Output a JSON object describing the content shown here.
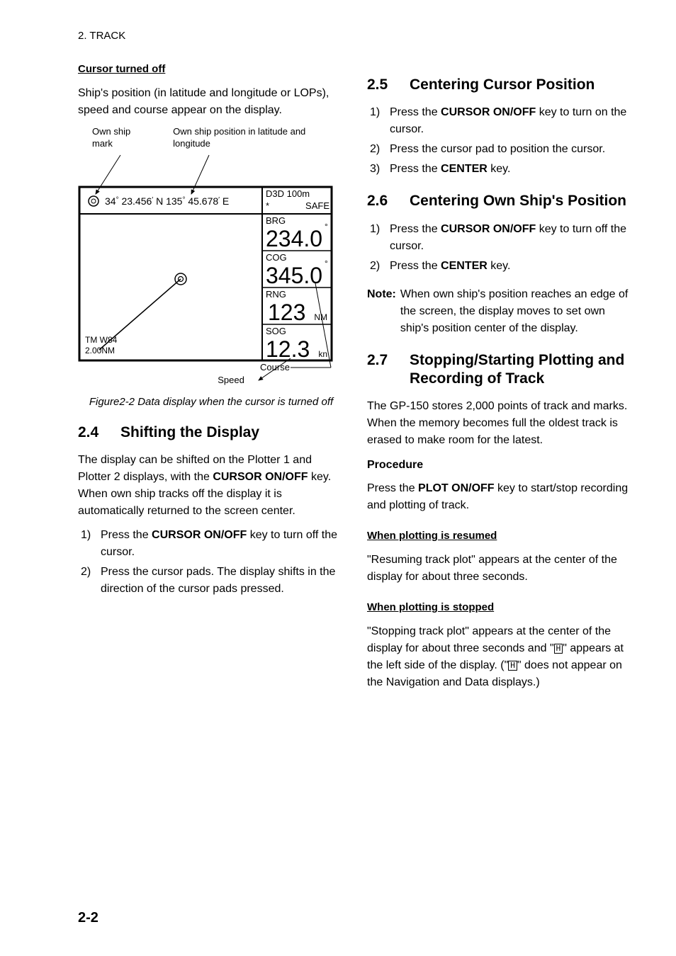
{
  "header": "2. TRACK",
  "page_number": "2-2",
  "left": {
    "cursor_off_title": "Cursor turned off",
    "cursor_off_para": "Ship's position (in latitude and longitude or LOPs), speed and course appear on the display.",
    "diagram": {
      "label_own_ship_mark": "Own ship mark",
      "label_own_ship_pos": "Own ship position in latitude and longitude",
      "lat": "34",
      "lat_min": "23.456",
      "lat_hemi": "N",
      "lon": "135",
      "lon_min": "45.678",
      "lon_hemi": "E",
      "d3d": "D3D 100m",
      "safe": "SAFE",
      "star": "*",
      "brg_label": "BRG",
      "brg_val": "234.0",
      "cog_label": "COG",
      "cog_val": "345.0",
      "rng_label": "RNG",
      "rng_val": "123",
      "rng_unit": "NM",
      "sog_label": "SOG",
      "sog_val": "12.3",
      "sog_unit": "kn",
      "tm": "TM W84",
      "scale": "2.00NM",
      "label_course": "Course",
      "label_speed": "Speed"
    },
    "fig_caption": "Figure2-2 Data display when the cursor is turned off",
    "s24num": "2.4",
    "s24title": "Shifting the Display",
    "s24para_pre": "The display can be shifted on the Plotter 1 and Plotter 2 displays, with the ",
    "s24para_key": "CURSOR ON/OFF",
    "s24para_post": " key. When own ship tracks off the display it is automatically returned to the screen center.",
    "s24_1_pre": "Press the ",
    "s24_1_key": "CURSOR ON/OFF",
    "s24_1_post": " key to turn off the cursor.",
    "s24_2": "Press the cursor pads. The display shifts in the direction of the cursor pads pressed."
  },
  "right": {
    "s25num": "2.5",
    "s25title": "Centering Cursor Position",
    "s25_1_pre": "Press the ",
    "s25_1_key": "CURSOR ON/OFF",
    "s25_1_post": " key to turn on the cursor.",
    "s25_2": "Press the cursor pad to position the cursor.",
    "s25_3_pre": "Press the ",
    "s25_3_key": "CENTER",
    "s25_3_post": " key.",
    "s26num": "2.6",
    "s26title": "Centering Own Ship's Position",
    "s26_1_pre": "Press the ",
    "s26_1_key": "CURSOR ON/OFF",
    "s26_1_post": " key to turn off the cursor.",
    "s26_2_pre": "Press the ",
    "s26_2_key": "CENTER",
    "s26_2_post": " key.",
    "note_label": "Note:",
    "note_body": "When own ship's position reaches an edge of the screen, the display moves to set own ship's position center of the display.",
    "s27num": "2.7",
    "s27title": "Stopping/Starting Plotting and Recording of Track",
    "s27para": "The GP-150 stores 2,000 points of track and marks. When the memory becomes full the oldest track is erased to make room for the latest.",
    "proc": "Procedure",
    "proc_pre": "Press the ",
    "proc_key": "PLOT ON/OFF",
    "proc_post": " key to start/stop recording and plotting of track.",
    "resumed_title": "When plotting is resumed",
    "resumed_body": "\"Resuming track plot\" appears at the center of the display for about three seconds.",
    "stopped_title": "When plotting is stopped",
    "stopped_p1": "\"Stopping track plot\" appears at the center of the display for about three seconds and \"",
    "stopped_p2": "\" appears at the left side of the display. (\"",
    "stopped_p3": "\" does not appear on the Navigation and Data displays.)",
    "h_glyph": "H"
  }
}
